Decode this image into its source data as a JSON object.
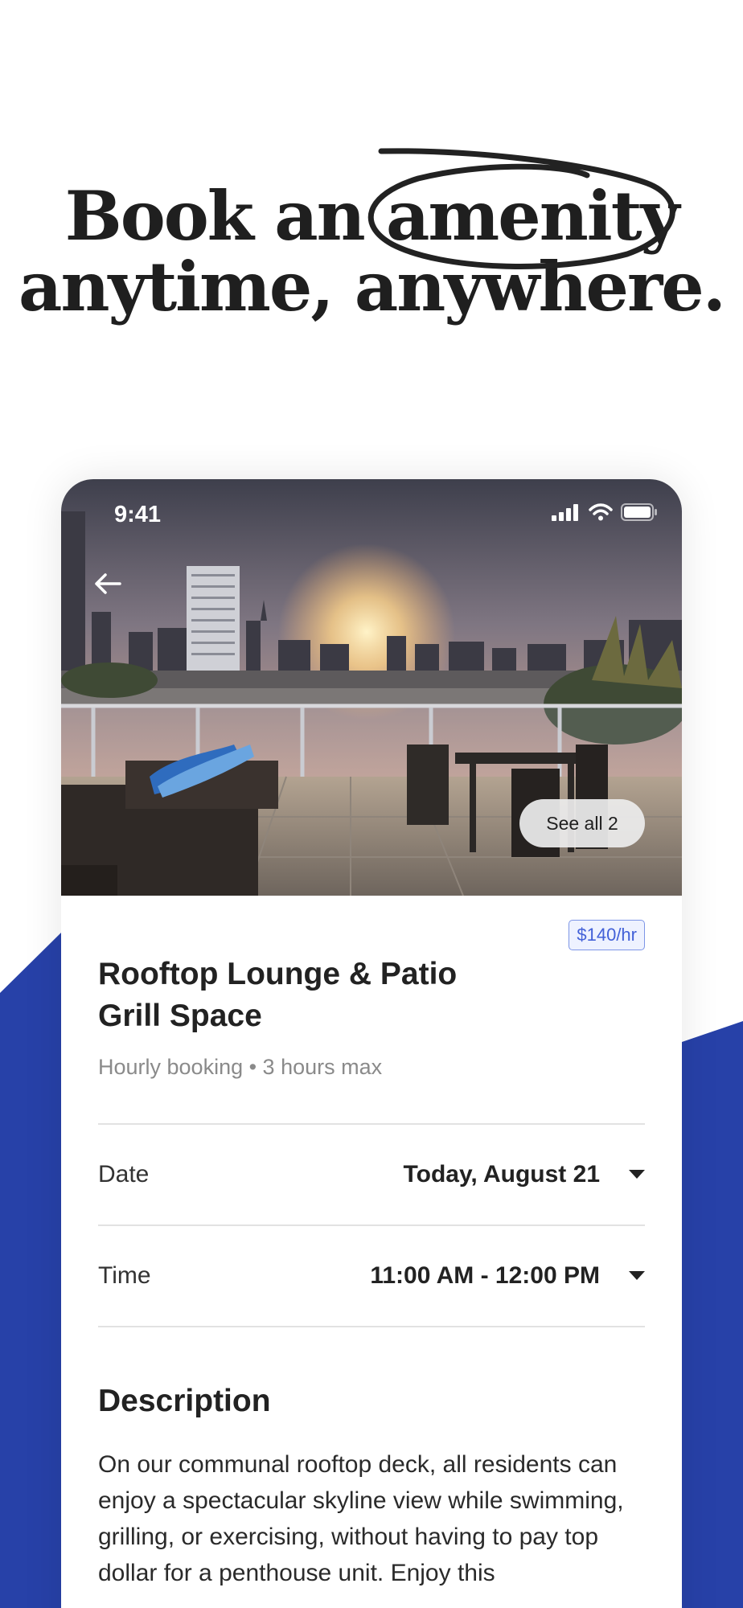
{
  "headline": {
    "line1_prefix": "Book an ",
    "line1_highlight": "amenity",
    "line2": "anytime, anywhere."
  },
  "colors": {
    "brand_blue": "#2741a8",
    "headline_text": "#1f1f1f",
    "price_badge": "#4361d8"
  },
  "status_bar": {
    "time": "9:41",
    "icons": [
      "signal-icon",
      "wifi-icon",
      "battery-icon"
    ]
  },
  "hero": {
    "back_icon": "arrow-left-icon",
    "see_all_label": "See all 2"
  },
  "amenity": {
    "price": "$140/hr",
    "title": "Rooftop Lounge & Patio Grill Space",
    "subtitle": "Hourly booking • 3 hours max"
  },
  "booking": {
    "date_label": "Date",
    "date_value": "Today, August 21",
    "time_label": "Time",
    "time_value": "11:00 AM - 12:00 PM"
  },
  "description": {
    "heading": "Description",
    "text": "On our communal rooftop deck, all residents can enjoy a spectacular skyline view while swimming, grilling, or exercising, without having to pay top dollar for a penthouse unit. Enjoy this"
  }
}
